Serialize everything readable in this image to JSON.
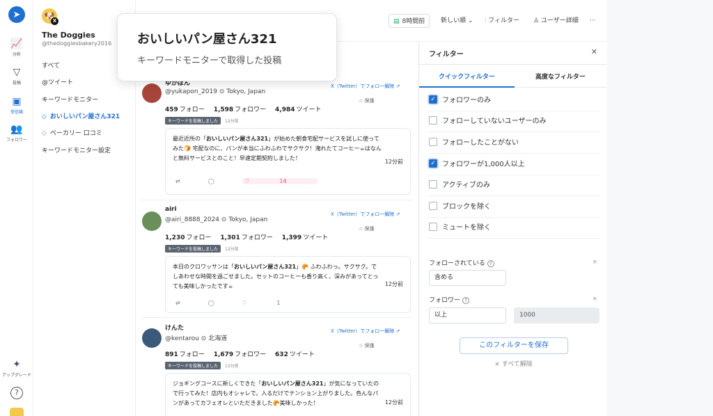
{
  "rail": {
    "items": [
      {
        "label": "分析"
      },
      {
        "label": "投稿"
      },
      {
        "label": "受信箱"
      },
      {
        "label": "フォロワー"
      },
      {
        "label": "アップグレード"
      }
    ]
  },
  "account": {
    "name": "The Doggies",
    "handle": "@thedoggiesbakery2016"
  },
  "sidebar": {
    "items": [
      {
        "label": "すべて"
      },
      {
        "label": "@ツイート"
      },
      {
        "label": "キーワードモニター"
      },
      {
        "label": "おいしいパン屋さん321"
      },
      {
        "label": "ベーカリー 口コミ"
      },
      {
        "label": "キーワードモニター設定"
      }
    ]
  },
  "topbar": {
    "time": "8時間前",
    "sort": "新しい順",
    "filter": "フィルター",
    "user_detail": "ユーザー詳細",
    "more": "···"
  },
  "tooltip": {
    "title": "おいしいパン屋さん321",
    "subtitle": "キーワードモニターで取得した投稿"
  },
  "tweets": [
    {
      "name": "ゆかぽん",
      "handle": "@yukapon_2019",
      "location": "Tokyo, Japan",
      "follow_link": "X（Twitter）でフォロー解除",
      "save": "保護",
      "following": "459",
      "followers": "1,598",
      "tweets": "4,984",
      "following_label": "フォロー",
      "followers_label": "フォロワー",
      "tweets_label": "ツイート",
      "badge": "キーワードを投稿しました",
      "badge_time": "12分前",
      "text_pre": "最近近所の「",
      "text_bold": "おいしいパン屋さん321",
      "text_post": "」が始めた朝食宅配サービスを試しに使ってみた🍞 宅配なのに、パンが本当にふわふわでサクサク！淹れたてコーヒー☕はなんと無料サービスとのこと！早速定期契約しました！",
      "ago": "12分前",
      "likes": "14"
    },
    {
      "name": "airi",
      "handle": "@airi_8888_2024",
      "location": "Tokyo, Japan",
      "follow_link": "X（Twitter）でフォロー解除",
      "save": "保護",
      "following": "1,230",
      "followers": "1,301",
      "tweets": "1,399",
      "following_label": "フォロー",
      "followers_label": "フォロワー",
      "tweets_label": "ツイート",
      "badge": "キーワードを投稿しました",
      "badge_time": "12分前",
      "text_pre": "本日のクロワッサンは「",
      "text_bold": "おいしいパン屋さん321",
      "text_post": "」🥐 ふわふわっ。サクサク。でしあわせな時間を過ごせました。セットのコーヒーも香り高く、深みがあってとっても美味しかったです☕",
      "ago": "12分前",
      "likes": "1"
    },
    {
      "name": "けんた",
      "handle": "@kentarou",
      "location": "北海道",
      "follow_link": "X（Twitter）でフォロー解除",
      "save": "保護",
      "following": "891",
      "followers": "1,679",
      "tweets": "632",
      "following_label": "フォロー",
      "followers_label": "フォロワー",
      "tweets_label": "ツイート",
      "badge": "キーワードを投稿しました",
      "badge_time": "12分前",
      "text_pre": "ジョギングコースに新しくできた「",
      "text_bold": "おいしいパン屋さん321",
      "text_post": "」が気になっていたので行ってみた！店内もオシャレで。入るだけでテンション上がりました。色んなパンがあってカフェオレといただきました🥐美味しかった！",
      "ago": "12分前",
      "likes": ""
    }
  ],
  "filter": {
    "title": "フィルター",
    "tabs": [
      {
        "label": "クイックフィルター"
      },
      {
        "label": "高度なフィルター"
      }
    ],
    "options": [
      {
        "label": "フォロワーのみ",
        "checked": true
      },
      {
        "label": "フォローしていないユーザーのみ",
        "checked": false
      },
      {
        "label": "フォローしたことがない",
        "checked": false
      },
      {
        "label": "フォロワーが1,000人以上",
        "checked": true
      },
      {
        "label": "アクティブのみ",
        "checked": false
      },
      {
        "label": "ブロックを除く",
        "checked": false
      },
      {
        "label": "ミュートを除く",
        "checked": false
      }
    ],
    "followed_label": "フォローされている",
    "followed_value": "含める",
    "followers_label": "フォロワー",
    "followers_op": "以上",
    "followers_value": "1000",
    "save": "このフィルターを保存",
    "clear": "すべて解除"
  },
  "colors": {
    "accent": "#1f6fd1",
    "badge": "#5b6572"
  }
}
